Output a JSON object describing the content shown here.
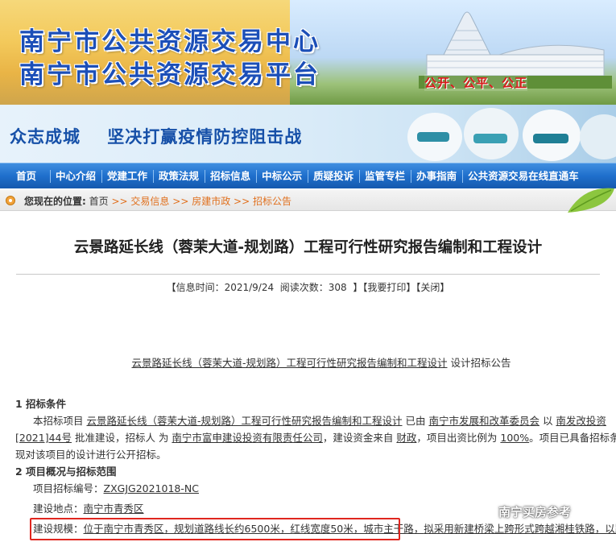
{
  "banner": {
    "title_line1": "南宁市公共资源交易中心",
    "title_line2": "南宁市公共资源交易平台",
    "slogan": "公开、公平、公正"
  },
  "epidemic": {
    "text": "众志成城    坚决打赢疫情防控阻击战"
  },
  "nav": {
    "items": [
      "首页",
      "中心介绍",
      "党建工作",
      "政策法规",
      "招标信息",
      "中标公示",
      "质疑投诉",
      "监管专栏",
      "办事指南",
      "公共资源交易在线直通车"
    ]
  },
  "breadcrumb": {
    "here": "您现在的位置:",
    "home": "首页",
    "sep": ">>",
    "level1": "交易信息",
    "level2": "房建市政",
    "level3": "招标公告"
  },
  "article": {
    "title": "云景路延长线（蓉茉大道-规划路）工程可行性研究报告编制和工程设计",
    "meta": {
      "open": "【",
      "info_label": "信息时间：",
      "date": "2021/9/24",
      "views_label": "阅读次数：",
      "views": "308",
      "close": "】",
      "print_label": "我要打印",
      "close_label": "关闭"
    }
  },
  "doc": {
    "head_title": "云景路延长线（蓉茉大道-规划路）工程可行性研究报告编制和工程设计",
    "head_suffix": " 设计招标公告",
    "s1_heading": "1 招标条件",
    "s1_p1_a": "本招标项目 ",
    "s1_p1_project": "云景路延长线（蓉茉大道-规划路）工程可行性研究报告编制和工程设计",
    "s1_p1_b": " 已由 ",
    "s1_p1_dept": "南宁市发展和改革委员会",
    "s1_p1_c": " 以 ",
    "s1_p1_doc1": "南发改投资",
    "s1_p2_doc2": "[2021]44号",
    "s1_p2_a": " 批准建设，招标人 为 ",
    "s1_p2_owner": "南宁市富申建设投资有限责任公司",
    "s1_p2_b": "，建设资金来自 ",
    "s1_p2_fund": "财政",
    "s1_p2_c": "，项目出资比例为 ",
    "s1_p2_ratio": "100%",
    "s1_p2_d": "。项目已具备招标条件,",
    "s1_p3": "现对该项目的设计进行公开招标。",
    "s2_heading": "2 项目概况与招标范围",
    "s2_code_label": "项目招标编号：",
    "s2_code": "ZXGJG2021018-NC",
    "s2_loc_label": "建设地点：",
    "s2_loc": "南宁市青秀区",
    "s2_scale_label": "建设规模：",
    "s2_scale_a": "位于南宁市青秀区，规划道路线长约6500米，红线宽度50米，城市主干路，",
    "s2_scale_b": "拟采用新建桥梁上跨形式跨越湘桂铁路，以路"
  },
  "watermark": {
    "text": "南宁买房参考"
  },
  "colors": {
    "title_blue": "#1c4fb8",
    "slogan_red": "#d71a1a",
    "nav_blue": "#1f6fcc",
    "crumb_orange": "#e0701e",
    "link_blue": "#1b4fb0",
    "highlight_red": "#e0261f"
  }
}
